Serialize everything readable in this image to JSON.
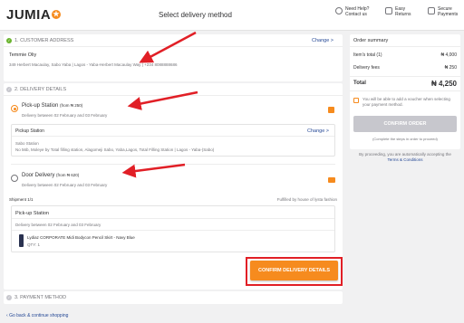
{
  "header": {
    "logo_text": "JUMIA",
    "logo_star": "★",
    "title": "Select delivery method",
    "help_line1": "Need Help?",
    "help_line2": "Contact us",
    "returns_line1": "Easy",
    "returns_line2": "Returns",
    "payments_line1": "Secure",
    "payments_line2": "Payments"
  },
  "address": {
    "heading": "1. CUSTOMER ADDRESS",
    "change_label": "Change >",
    "name": "Temmie Oliy",
    "line": "349 Herbert Macaulay, Sabo Yaba | Lagos - Yaba-Herbert Macaulay Way | +234 8088888686"
  },
  "delivery": {
    "heading": "2. DELIVERY DETAILS",
    "pickup": {
      "title": "Pick-up Station",
      "price": "(from ₦ 250)",
      "dates": "Delivery between 02 February and 03 February",
      "box_label": "Pickup Station",
      "change_label": "Change >",
      "station_name": "Sabo Station",
      "station_address": "No 56b, Moleye by Total filling station, Alagomeji Sabo, Yaba,Lagos, Total Filling Station | Lagos - Yaba-(Sabo)"
    },
    "door": {
      "title": "Door Delivery",
      "price": "(from ₦ 620)",
      "dates": "Delivery between 02 February and 03 February"
    },
    "shipment_label": "Shipment 1/1",
    "fulfilled_by": "Fulfilled by house of lysta fashion",
    "shipment_box": {
      "title": "Pick-up Station",
      "dates": "Delivery between 02 February and 03 February",
      "item_name": "Lydiaz CORPORATE Midi Bodycon Pencil Skirt - Navy Blue",
      "item_qty": "QTY: 1"
    },
    "confirm_button": "CONFIRM DELIVERY DETAILS"
  },
  "payment": {
    "heading": "3. PAYMENT METHOD"
  },
  "footer": {
    "back_link": "Go back & continue shopping"
  },
  "summary": {
    "heading": "Order summary",
    "items_label": "Item's total (1)",
    "items_value": "₦ 4,000",
    "fees_label": "Delivery fees",
    "fees_value": "₦ 250",
    "total_label": "Total",
    "total_value": "₦ 4,250",
    "voucher_note": "You will be able to add a voucher when selecting your payment method.",
    "confirm_order": "CONFIRM ORDER",
    "complete_note": "(Complete the steps in order to proceed)",
    "terms_line1": "By proceeding, you are automatically accepting the",
    "terms_line2": "Terms & Conditions"
  },
  "colors": {
    "accent": "#f68b1e",
    "highlight": "#e11f26",
    "success": "#6bb42f",
    "link": "#264996"
  },
  "icons": {
    "logo": "jumia-star-icon",
    "help": "help-icon",
    "returns": "returns-icon",
    "payments": "secure-payment-icon",
    "pickup": "pickup-station-icon",
    "door": "delivery-truck-icon",
    "back": "chevron-left-icon"
  }
}
